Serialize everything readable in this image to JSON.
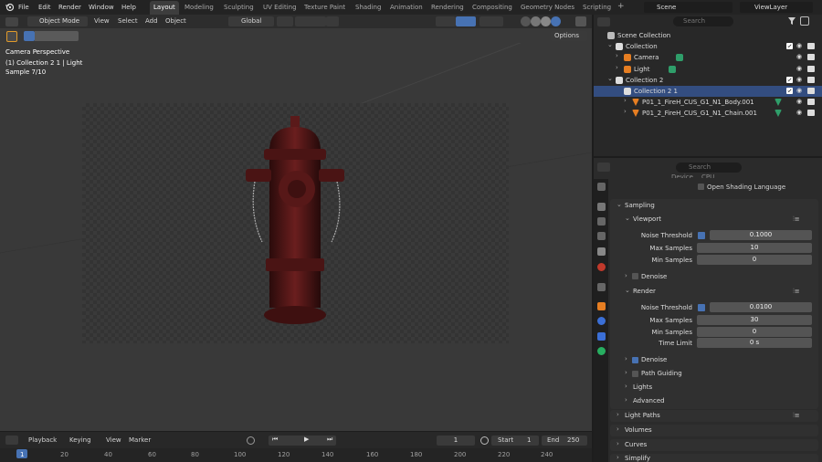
{
  "topbar": {
    "menus": [
      "File",
      "Edit",
      "Render",
      "Window",
      "Help"
    ],
    "workspaces": [
      "Layout",
      "Modeling",
      "Sculpting",
      "UV Editing",
      "Texture Paint",
      "Shading",
      "Animation",
      "Rendering",
      "Compositing",
      "Geometry Nodes",
      "Scripting"
    ],
    "active_workspace": "Layout",
    "add_tab": "+",
    "scene": "Scene",
    "view_layer": "ViewLayer"
  },
  "viewport": {
    "mode": "Object Mode",
    "menus": [
      "View",
      "Select",
      "Add",
      "Object"
    ],
    "transform": "Global",
    "options": "Options",
    "overlay_lines": [
      "Camera Perspective",
      "(1) Collection 2 1 | Light",
      "Sample 7/10"
    ]
  },
  "outliner": {
    "search_placeholder": "Search",
    "rows": [
      {
        "label": "Scene Collection",
        "indent": 0
      },
      {
        "label": "Collection",
        "indent": 1
      },
      {
        "label": "Camera",
        "indent": 2
      },
      {
        "label": "Light",
        "indent": 2
      },
      {
        "label": "Collection 2",
        "indent": 1
      },
      {
        "label": "Collection 2 1",
        "indent": 2
      },
      {
        "label": "P01_1_FireH_CUS_G1_N1_Body.001",
        "indent": 3
      },
      {
        "label": "P01_2_FireH_CUS_G1_N1_Chain.001",
        "indent": 3
      }
    ]
  },
  "properties": {
    "search_placeholder": "Search",
    "device_label": "Device",
    "device_value": "CPU",
    "open_shading": "Open Shading Language",
    "sampling": "Sampling",
    "viewport_section": "Viewport",
    "vp_noise_label": "Noise Threshold",
    "vp_noise": "0.1000",
    "vp_max_label": "Max Samples",
    "vp_max": "10",
    "vp_min_label": "Min Samples",
    "vp_min": "0",
    "denoise": "Denoise",
    "render_section": "Render",
    "r_noise_label": "Noise Threshold",
    "r_noise": "0.0100",
    "r_max_label": "Max Samples",
    "r_max": "30",
    "r_min_label": "Min Samples",
    "r_min": "0",
    "time_limit_label": "Time Limit",
    "time_limit": "0 s",
    "denoise2": "Denoise",
    "path_guiding": "Path Guiding",
    "lights": "Lights",
    "advanced": "Advanced",
    "light_paths": "Light Paths",
    "volumes": "Volumes",
    "curves": "Curves",
    "simplify": "Simplify"
  },
  "timeline": {
    "menus": [
      "Playback",
      "Keying",
      "View",
      "Marker"
    ],
    "current_frame": "1",
    "start_label": "Start",
    "start": "1",
    "end_label": "End",
    "end": "250",
    "ticks": [
      "1",
      "20",
      "40",
      "60",
      "80",
      "100",
      "120",
      "140",
      "160",
      "180",
      "200",
      "220",
      "240"
    ]
  },
  "colors": {
    "accent": "#4772b3",
    "selected_row": "#334d80",
    "active_checkbox": "#4772b3"
  }
}
